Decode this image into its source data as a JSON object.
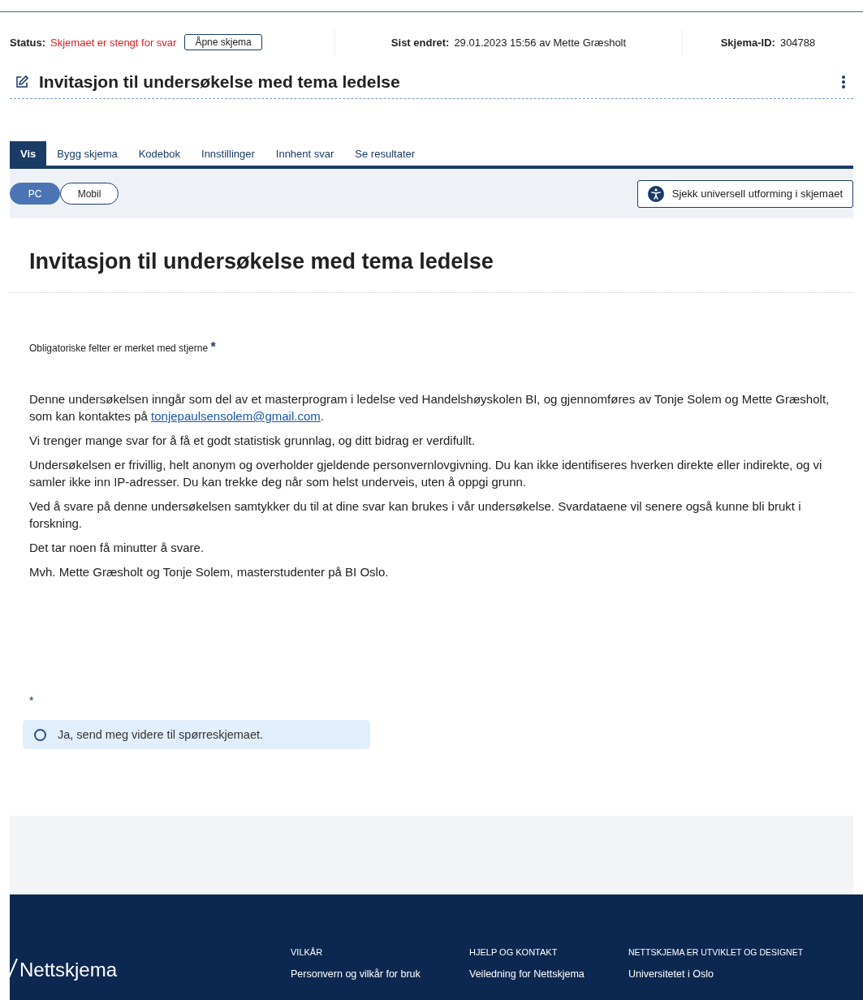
{
  "status_bar": {
    "status_label": "Status:",
    "status_value": "Skjemaet er stengt for svar",
    "open_button": "Åpne skjema",
    "changed_label": "Sist endret:",
    "changed_value": "29.01.2023 15:56 av Mette Græsholt",
    "id_label": "Skjema-ID:",
    "id_value": "304788"
  },
  "form_title": "Invitasjon til undersøkelse med tema ledelse",
  "tabs": [
    {
      "label": "Vis",
      "selected": true
    },
    {
      "label": "Bygg skjema",
      "selected": false
    },
    {
      "label": "Kodebok",
      "selected": false
    },
    {
      "label": "Innstillinger",
      "selected": false
    },
    {
      "label": "Innhent svar",
      "selected": false
    },
    {
      "label": "Se resultater",
      "selected": false
    }
  ],
  "device_toggle": [
    {
      "label": "PC",
      "selected": true
    },
    {
      "label": "Mobil",
      "selected": false
    }
  ],
  "accessibility_button": "Sjekk universell utforming i skjemaet",
  "preview": {
    "heading": "Invitasjon til undersøkelse med tema ledelse",
    "required_note": "Obligatoriske felter er merket med stjerne",
    "required_mark": "*",
    "intro_lead": "Denne undersøkelsen inngår som del av et masterprogram i ledelse ved Handelshøyskolen BI, og gjennomføres av Tonje Solem og Mette Græsholt, som kan kontaktes på ",
    "intro_link": "tonjepaulsensolem@gmail.com",
    "intro_tail": ".",
    "paragraphs": [
      "Vi trenger mange svar for å få et godt statistisk grunnlag, og ditt bidrag er verdifullt.",
      "Undersøkelsen er frivillig, helt anonym og overholder gjeldende personvernlovgivning. Du kan ikke identifiseres hverken direkte eller indirekte, og vi samler ikke inn IP-adresser. Du kan trekke deg når som helst underveis, uten å oppgi grunn.",
      "Ved å svare på denne undersøkelsen samtykker du til at dine svar kan brukes i vår undersøkelse. Svardataene vil senere også kunne bli brukt i forskning.",
      "Det tar noen få minutter å svare.",
      "Mvh. Mette Græsholt og Tonje Solem, masterstudenter på BI Oslo."
    ],
    "question_mark": "*",
    "options": [
      {
        "label": "Ja, send meg videre til spørreskjemaet.",
        "selected": false
      }
    ]
  },
  "footer": {
    "logo": "Nettskjema",
    "columns": [
      {
        "heading": "VILKÅR",
        "link": "Personvern og vilkår for bruk"
      },
      {
        "heading": "HJELP OG KONTAKT",
        "link": "Veiledning for Nettskjema"
      },
      {
        "heading": "NETTSKJEMA ER UTVIKLET OG DESIGNET",
        "link": "Universitetet i Oslo"
      }
    ]
  }
}
